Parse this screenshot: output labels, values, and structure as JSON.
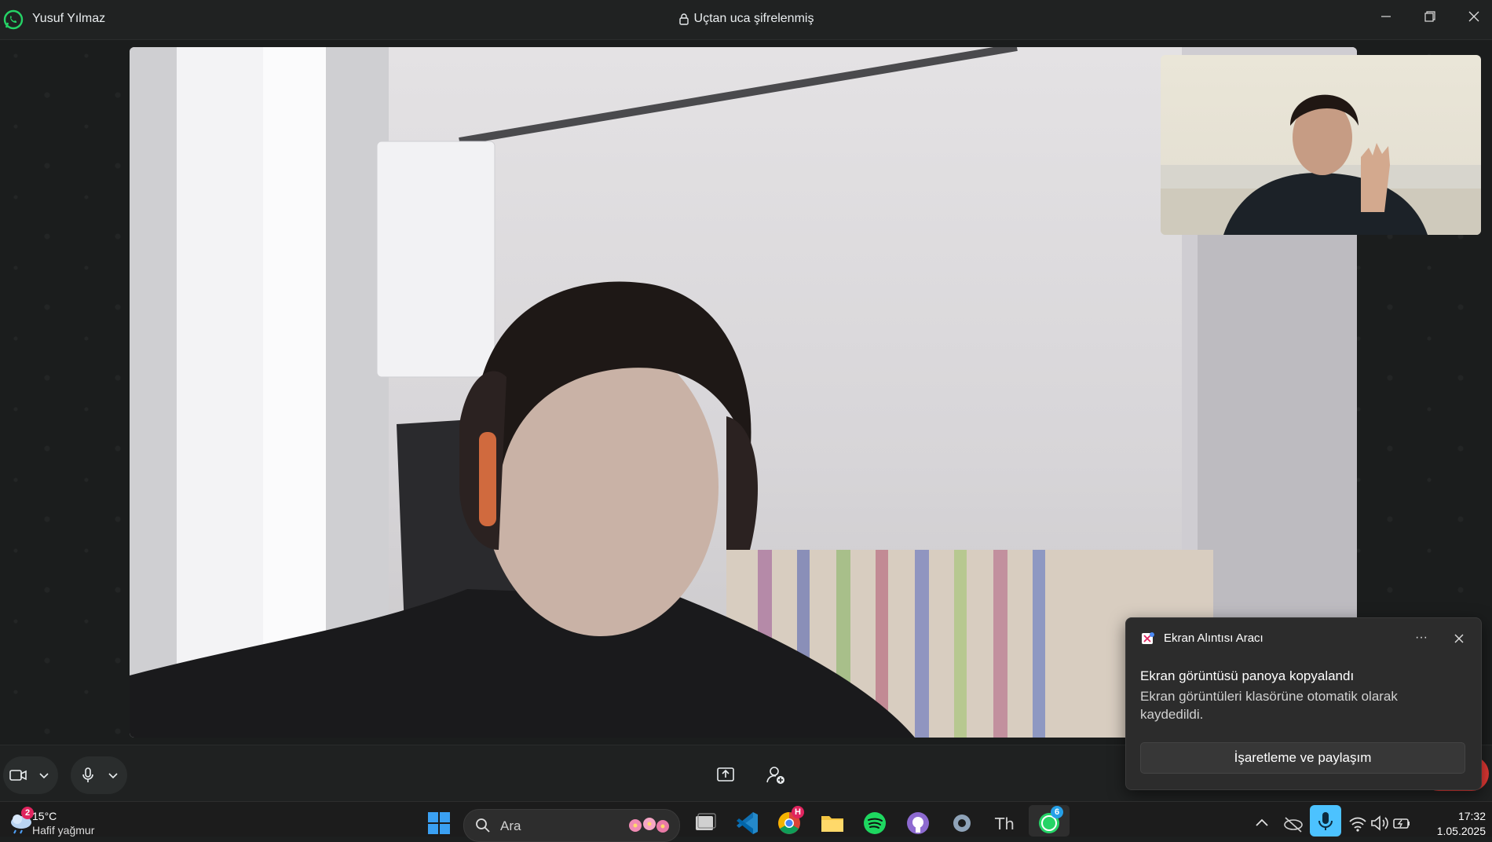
{
  "window": {
    "contact_name": "Yusuf Yılmaz",
    "encryption_text": "Uçtan uca şifrelenmiş"
  },
  "call": {
    "controls": [
      "camera-toggle",
      "camera-options",
      "microphone-toggle",
      "microphone-options",
      "share-screen",
      "add-participant"
    ]
  },
  "toast": {
    "app_name": "Ekran Alıntısı Aracı",
    "more_label": "···",
    "heading": "Ekran görüntüsü panoya kopyalandı",
    "body": "Ekran görüntüleri klasörüne otomatik olarak kaydedildi.",
    "action_label": "İşaretleme ve paylaşım"
  },
  "taskbar": {
    "weather_temp": "15°C",
    "weather_condition": "Hafif yağmur",
    "weather_badge": "2",
    "search_placeholder": "Ara",
    "chrome_badge": "H",
    "whatsapp_badge": "6",
    "time": "17:32",
    "date": "1.05.2025"
  },
  "colors": {
    "whatsapp_green": "#25d366",
    "accent_blue": "#4cc2ff",
    "end_call_red": "#e53935"
  }
}
